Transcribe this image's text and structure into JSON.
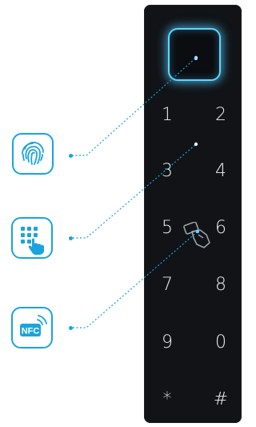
{
  "keypad": {
    "keys": [
      "1",
      "2",
      "3",
      "4",
      "5",
      "6",
      "7",
      "8",
      "9",
      "0",
      "*",
      "#"
    ]
  },
  "features": [
    {
      "name": "fingerprint",
      "icon": "fingerprint-icon"
    },
    {
      "name": "keypad",
      "icon": "keypad-touch-icon"
    },
    {
      "name": "nfc",
      "label": "NFC",
      "icon": "nfc-icon"
    }
  ],
  "colors": {
    "accent": "#1aa3df",
    "panel": "#111316",
    "glow": "#5fd6ff",
    "key_text": "#e9eef3"
  }
}
